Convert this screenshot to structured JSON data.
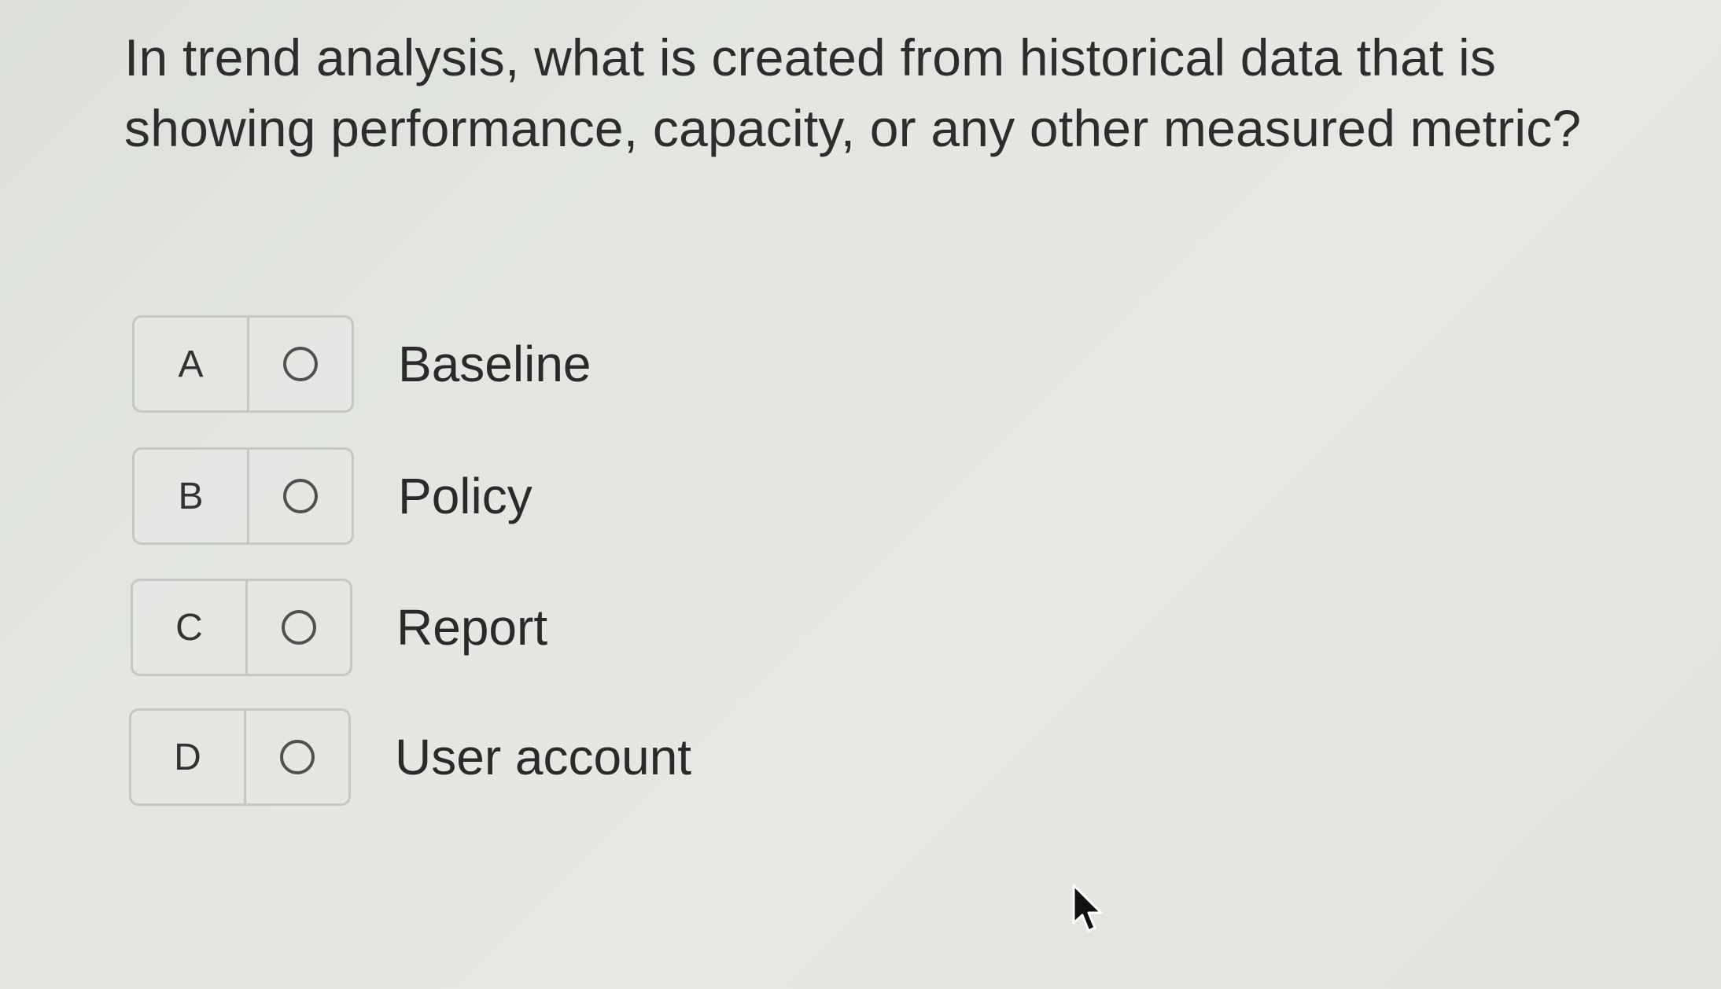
{
  "question": {
    "text": "In trend analysis, what is created from historical data that is showing performance, capacity, or any other measured metric?"
  },
  "options": [
    {
      "letter": "A",
      "label": "Baseline"
    },
    {
      "letter": "B",
      "label": "Policy"
    },
    {
      "letter": "C",
      "label": "Report"
    },
    {
      "letter": "D",
      "label": "User account"
    }
  ],
  "colors": {
    "background": "#e3e6e1",
    "border": "#c6c8c4",
    "text": "#2d2d2d"
  },
  "icons": {
    "radio": "radio-unchecked-icon",
    "cursor": "mouse-pointer-icon"
  }
}
